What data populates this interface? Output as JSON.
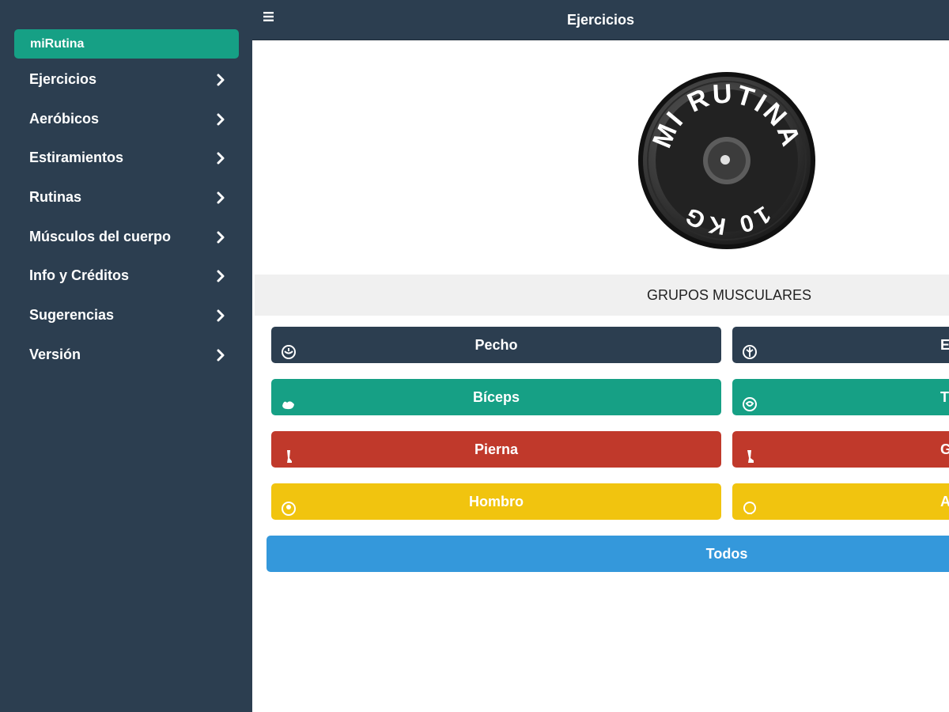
{
  "app": {
    "brand": "miRutina",
    "topbar_title": "Ejercicios",
    "menu_icon": "hamburger-menu-icon"
  },
  "sidebar": {
    "items": [
      {
        "label": "Ejercicios",
        "icon": "chevron-right-icon"
      },
      {
        "label": "Aeróbicos",
        "icon": "chevron-right-icon"
      },
      {
        "label": "Estiramientos",
        "icon": "chevron-right-icon"
      },
      {
        "label": "Rutinas",
        "icon": "chevron-right-icon"
      },
      {
        "label": "Músculos del cuerpo",
        "icon": "chevron-right-icon"
      },
      {
        "label": "Info y Créditos",
        "icon": "chevron-right-icon"
      },
      {
        "label": "Sugerencias",
        "icon": "chevron-right-icon"
      },
      {
        "label": "Versión",
        "icon": "chevron-right-icon"
      }
    ]
  },
  "logo": {
    "text_top": "MI RUTINA",
    "text_bottom": "10 KG",
    "icon": "weight-plate-logo"
  },
  "section": {
    "title": "GRUPOS MUSCULARES"
  },
  "muscle_groups": {
    "left": [
      {
        "label": "Pecho",
        "icon": "chest-icon",
        "color": "#2c3e50"
      },
      {
        "label": "Bíceps",
        "icon": "biceps-icon",
        "color": "#16a085"
      },
      {
        "label": "Pierna",
        "icon": "leg-icon",
        "color": "#c0392b"
      },
      {
        "label": "Hombro",
        "icon": "shoulder-icon",
        "color": "#f1c40f"
      }
    ],
    "right": [
      {
        "label": "E",
        "icon": "back-icon",
        "color": "#2c3e50"
      },
      {
        "label": "T",
        "icon": "triceps-icon",
        "color": "#16a085"
      },
      {
        "label": "G",
        "icon": "calf-icon",
        "color": "#c0392b"
      },
      {
        "label": "Ab",
        "icon": "abs-icon",
        "color": "#f1c40f"
      }
    ]
  },
  "all_button": {
    "label": "Todos",
    "color": "#3498db"
  },
  "colors": {
    "navy": "#2c3e50",
    "green": "#16a085",
    "red": "#c0392b",
    "yellow": "#f1c40f",
    "blue": "#3498db",
    "section_bg": "#f0f0f0"
  }
}
